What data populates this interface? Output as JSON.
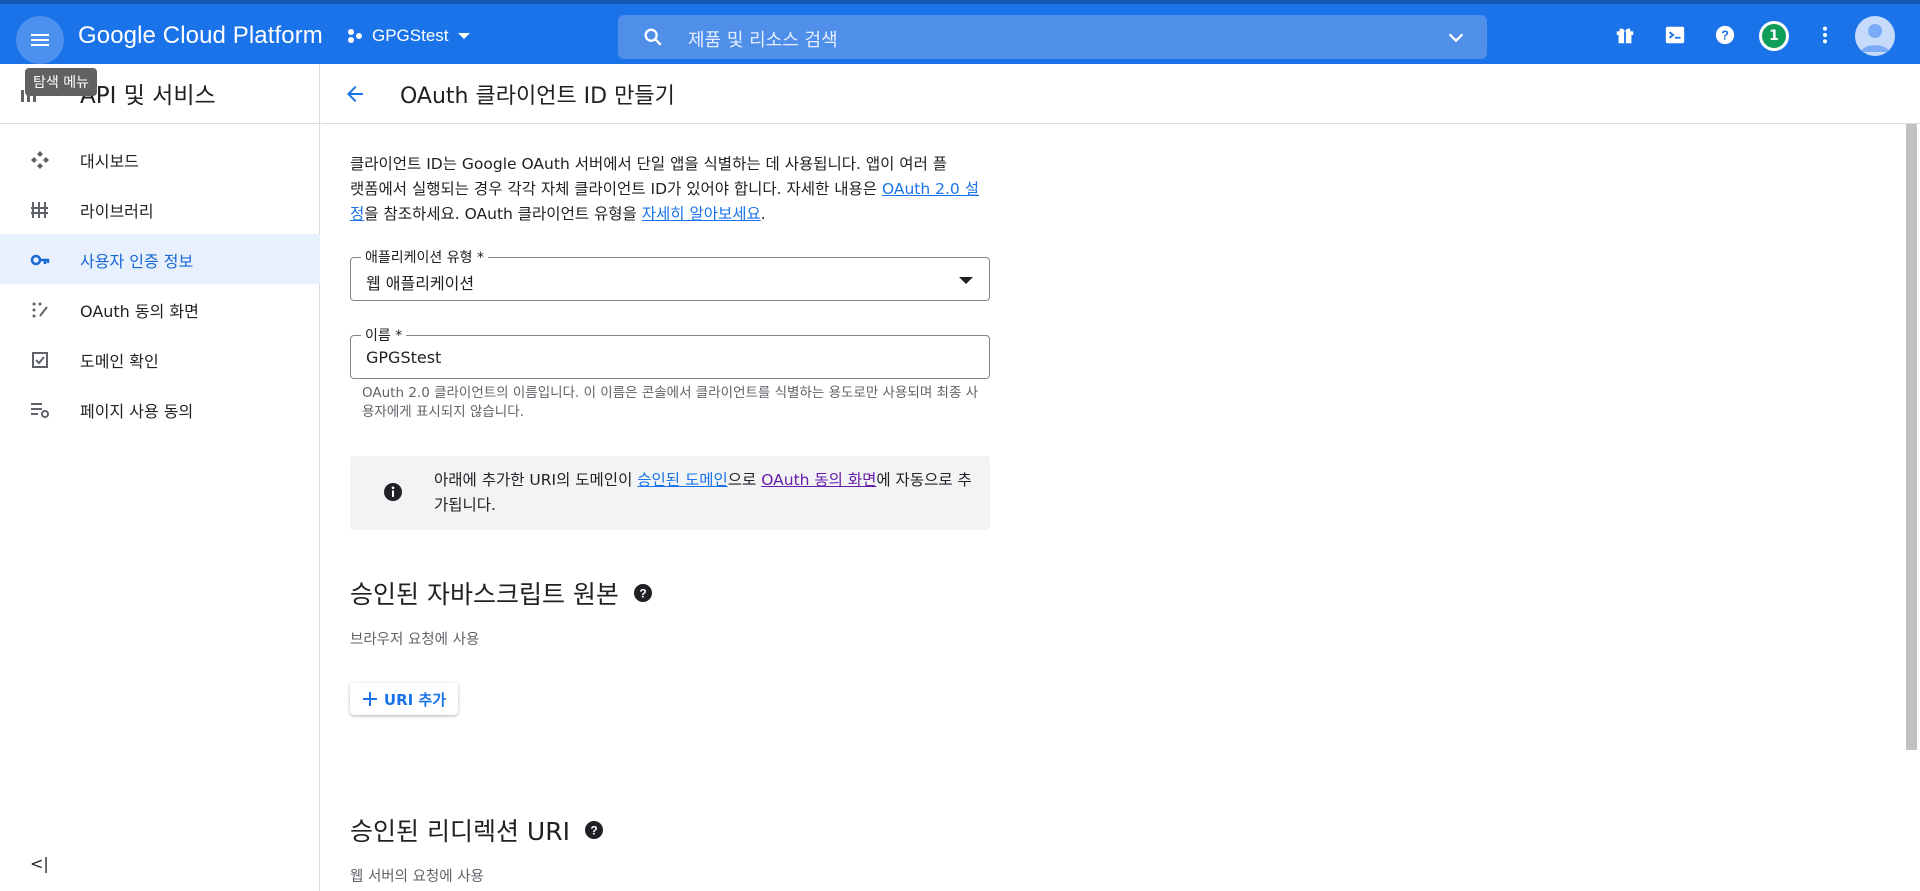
{
  "topbar": {
    "menu_tooltip": "탐색 메뉴",
    "brand": "Google Cloud Platform",
    "project_name": "GPGStest",
    "search_placeholder": "제품 및 리소스 검색",
    "notification_count": "1",
    "icons": [
      "menu-icon",
      "project-icon",
      "chevron-down-icon",
      "search-icon",
      "gift-icon",
      "terminal-icon",
      "help-icon",
      "more-vert-icon",
      "avatar-icon"
    ],
    "color": "#1a73e8"
  },
  "sidebar": {
    "title": "API 및 서비스",
    "items": [
      {
        "label": "대시보드",
        "icon": "dashboard-icon",
        "active": false
      },
      {
        "label": "라이브러리",
        "icon": "library-icon",
        "active": false
      },
      {
        "label": "사용자 인증 정보",
        "icon": "key-icon",
        "active": true
      },
      {
        "label": "OAuth 동의 화면",
        "icon": "consent-icon",
        "active": false
      },
      {
        "label": "도메인 확인",
        "icon": "checkbox-icon",
        "active": false
      },
      {
        "label": "페이지 사용 동의",
        "icon": "settings-list-icon",
        "active": false
      }
    ],
    "collapse_glyph": "<|"
  },
  "main": {
    "page_title": "OAuth 클라이언트 ID 만들기",
    "intro": {
      "line1": "클라이언트 ID는 Google OAuth 서버에서 단일 앱을 식별하는 데 사용됩니다. 앱이 여러 플",
      "line2a": "랫폼에서 실행되는 경우 각각 자체 클라이언트 ID가 있어야 합니다. 자세한 내용은 ",
      "link1": "OAuth 2.0 설정",
      "line3a": "을 참조하세요. OAuth 클라이언트 유형을 ",
      "link2": "자세히 알아보세요",
      "line3b": "."
    },
    "app_type": {
      "label": "애플리케이션 유형 *",
      "value": "웹 애플리케이션"
    },
    "name_field": {
      "label": "이름 *",
      "value": "GPGStest"
    },
    "name_hint": "OAuth 2.0 클라이언트의 이름입니다. 이 이름은 콘솔에서 클라이언트를 식별하는 용도로만 사용되며 최종 사용자에게 표시되지 않습니다.",
    "info": {
      "text_a": "아래에 추가한 URI의 도메인이 ",
      "link_a": "승인된 도메인",
      "text_b": "으로 ",
      "link_b": "OAuth 동의 화면",
      "text_c": "에 자동으로 추가됩니다."
    },
    "js_origins": {
      "title": "승인된 자바스크립트 원본",
      "subtitle": "브라우저 요청에 사용",
      "add_label": "URI 추가"
    },
    "redirect_uris": {
      "title": "승인된 리디렉션 URI",
      "subtitle": "웹 서버의 요청에 사용"
    }
  }
}
